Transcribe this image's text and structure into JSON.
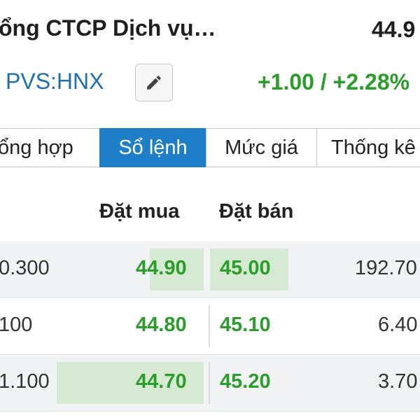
{
  "header": {
    "company_name": "ổng CTCP Dịch vụ…",
    "price": "44.9",
    "ticker": "PVS:HNX",
    "edit_icon": "pencil-icon",
    "change": "+1.00 / +2.28%"
  },
  "tabs": [
    {
      "label": "ổng hợp",
      "active": false
    },
    {
      "label": "Sổ lệnh",
      "active": true
    },
    {
      "label": "Mức giá",
      "active": false
    },
    {
      "label": "Thống kê",
      "active": false
    }
  ],
  "order_book": {
    "bid_header": "Đặt mua",
    "ask_header": "Đặt bán",
    "rows": [
      {
        "bid_volume": "0.300",
        "bid_price": "44.90",
        "ask_price": "45.00",
        "ask_volume": "192.70"
      },
      {
        "bid_volume": "100",
        "bid_price": "44.80",
        "ask_price": "45.10",
        "ask_volume": "6.40"
      },
      {
        "bid_volume": "1.100",
        "bid_price": "44.70",
        "ask_price": "45.20",
        "ask_volume": "3.70"
      }
    ]
  },
  "colors": {
    "positive": "#2a9d2a",
    "ticker": "#1f6fae",
    "active_tab": "#1e7ec8",
    "volume_bar": "#d6ead3"
  }
}
